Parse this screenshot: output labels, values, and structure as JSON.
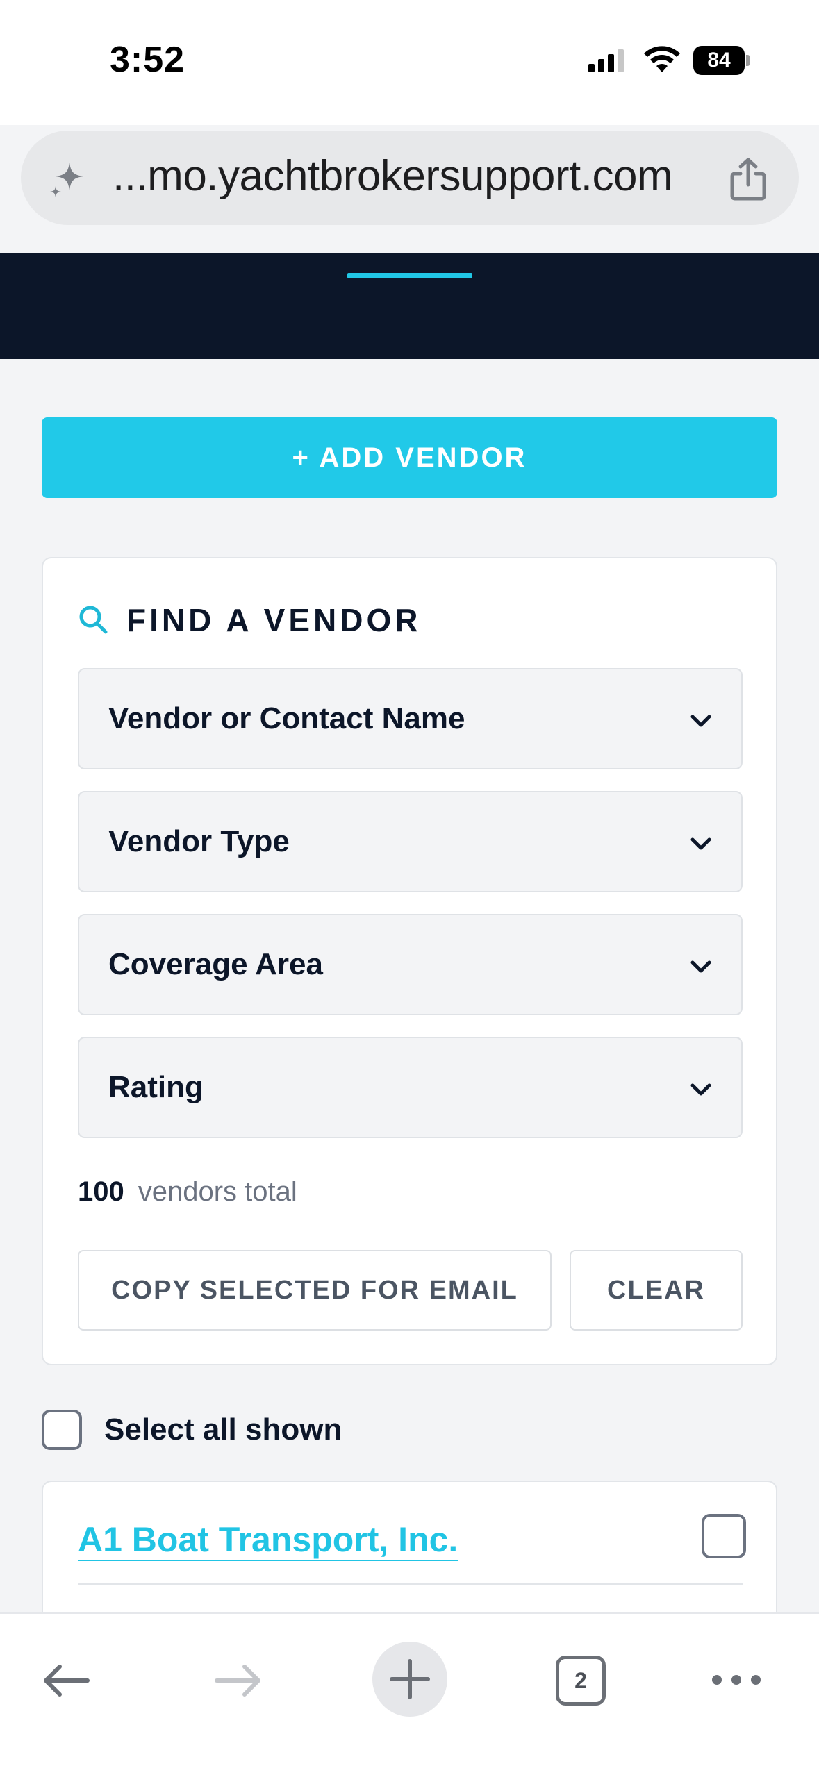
{
  "status_bar": {
    "time": "3:52",
    "battery": "84"
  },
  "browser": {
    "url": "...mo.yachtbrokersupport.com",
    "tab_count": "2"
  },
  "actions": {
    "add_vendor_label": "+ ADD VENDOR"
  },
  "find_vendor": {
    "title": "FIND A VENDOR",
    "filters": [
      {
        "label": "Vendor or Contact Name"
      },
      {
        "label": "Vendor Type"
      },
      {
        "label": "Coverage Area"
      },
      {
        "label": "Rating"
      }
    ],
    "total_count": "100",
    "total_label": "vendors total",
    "copy_button": "COPY SELECTED FOR EMAIL",
    "clear_button": "CLEAR"
  },
  "list": {
    "select_all_label": "Select all shown",
    "vendors": [
      {
        "name": "A1 Boat Transport, Inc."
      }
    ]
  },
  "colors": {
    "accent": "#21c9e8",
    "dark_header": "#0c1629",
    "background": "#f3f4f6"
  }
}
